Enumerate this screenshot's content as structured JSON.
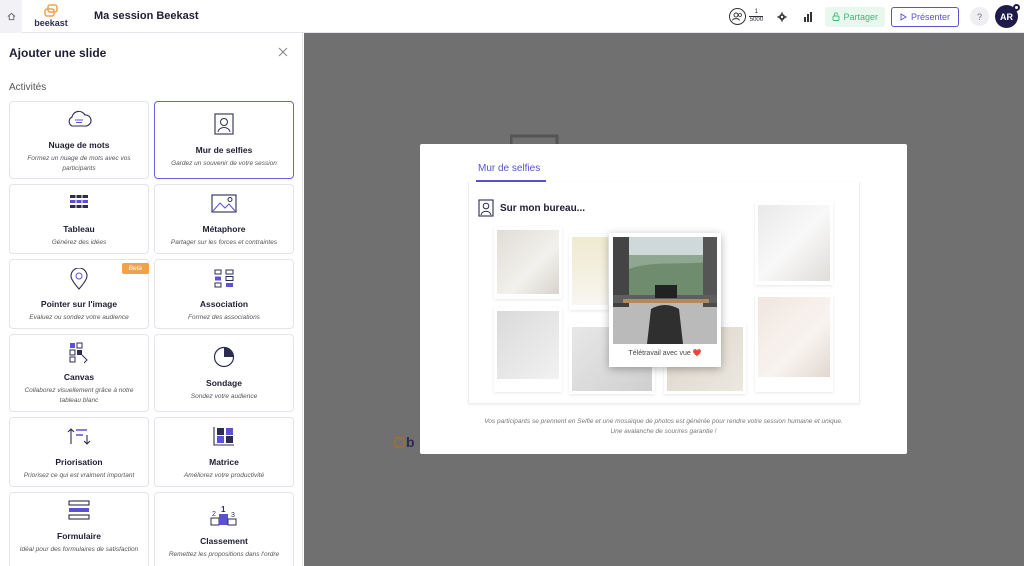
{
  "app": {
    "logo_text": "beekast",
    "session_title": "Ma session Beekast"
  },
  "toolbar": {
    "participants_current": "1",
    "participants_max": "5000",
    "share_label": "Partager",
    "present_label": "Présenter",
    "help_label": "?",
    "avatar_initials": "AR"
  },
  "panel": {
    "title": "Ajouter une slide",
    "section": "Activités",
    "cards": [
      {
        "name": "Nuage de mots",
        "desc": "Formez un nuage de mots avec vos participants",
        "icon": "cloud-icon"
      },
      {
        "name": "Mur de selfies",
        "desc": "Gardez un souvenir de votre session",
        "icon": "selfie-icon",
        "selected": true
      },
      {
        "name": "Tableau",
        "desc": "Générez des idées",
        "icon": "table-icon"
      },
      {
        "name": "Métaphore",
        "desc": "Partager sur les forces et contraintes",
        "icon": "image-icon"
      },
      {
        "name": "Pointer sur l'image",
        "desc": "Evaluez ou sondez votre audience",
        "icon": "pin-icon",
        "badge": "Beta"
      },
      {
        "name": "Association",
        "desc": "Formez des associations",
        "icon": "association-icon"
      },
      {
        "name": "Canvas",
        "desc": "Collaborez visuellement grâce à notre tableau blanc",
        "icon": "canvas-icon"
      },
      {
        "name": "Sondage",
        "desc": "Sondez votre audience",
        "icon": "pie-chart-icon"
      },
      {
        "name": "Priorisation",
        "desc": "Priorisez ce qui est vraiment important",
        "icon": "sort-icon"
      },
      {
        "name": "Matrice",
        "desc": "Améliorez votre productivité",
        "icon": "matrix-icon"
      },
      {
        "name": "Formulaire",
        "desc": "Idéal pour des formulaires de satisfaction",
        "icon": "form-icon"
      },
      {
        "name": "Classement",
        "desc": "Remettez les propositions dans l'ordre",
        "icon": "podium-icon"
      }
    ]
  },
  "preview": {
    "tab_label": "Mur de selfies",
    "heading": "Sur mon bureau...",
    "front_caption": "Télétravail avec vue",
    "heart": "❤️",
    "footnote_line1": "Vos participants se prennent en Selfie et une mosaïque de photos est générée pour rendre votre session humaine et unique.",
    "footnote_line2": "Une avalanche de sourires garantie !"
  },
  "colors": {
    "accent": "#5b50d6",
    "share_green": "#3fb873",
    "beta_orange": "#f0a24a",
    "stage_gray": "#707070"
  }
}
